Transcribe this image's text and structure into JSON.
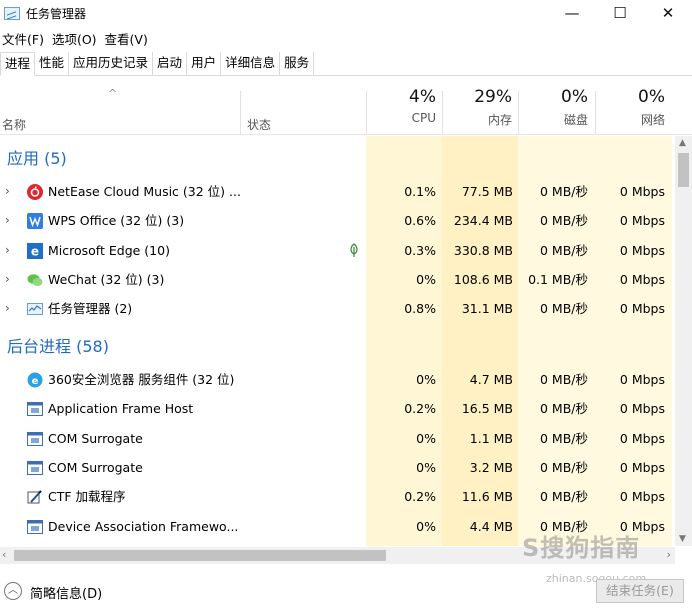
{
  "window": {
    "title": "任务管理器",
    "minimize": "—",
    "maximize": "☐",
    "close": "✕"
  },
  "menu": [
    "文件(F)",
    "选项(O)",
    "查看(V)"
  ],
  "tabs": [
    "进程",
    "性能",
    "应用历史记录",
    "启动",
    "用户",
    "详细信息",
    "服务"
  ],
  "active_tab": "进程",
  "header": {
    "sort_arrow": "^",
    "name": "名称",
    "status": "状态",
    "cpu_pct": "4%",
    "cpu_label": "CPU",
    "mem_pct": "29%",
    "mem_label": "内存",
    "disk_pct": "0%",
    "disk_label": "磁盘",
    "net_pct": "0%",
    "net_label": "网络"
  },
  "groups": {
    "apps_title": "应用 (5)",
    "background_title": "后台进程 (58)"
  },
  "apps": [
    {
      "name": "NetEase Cloud Music (32 位) ...",
      "icon": "netease-music-icon",
      "cpu": "0.1%",
      "mem": "77.5 MB",
      "disk": "0 MB/秒",
      "net": "0 Mbps"
    },
    {
      "name": "WPS Office (32 位) (3)",
      "icon": "wps-icon",
      "cpu": "0.6%",
      "mem": "234.4 MB",
      "disk": "0 MB/秒",
      "net": "0 Mbps"
    },
    {
      "name": "Microsoft Edge (10)",
      "icon": "edge-icon",
      "cpu": "0.3%",
      "mem": "330.8 MB",
      "disk": "0 MB/秒",
      "net": "0 Mbps"
    },
    {
      "name": "WeChat (32 位) (3)",
      "icon": "wechat-icon",
      "cpu": "0%",
      "mem": "108.6 MB",
      "disk": "0.1 MB/秒",
      "net": "0 Mbps"
    },
    {
      "name": "任务管理器 (2)",
      "icon": "task-manager-icon",
      "cpu": "0.8%",
      "mem": "31.1 MB",
      "disk": "0 MB/秒",
      "net": "0 Mbps"
    }
  ],
  "background": [
    {
      "name": "360安全浏览器 服务组件 (32 位)",
      "icon": "360-browser-icon",
      "cpu": "0%",
      "mem": "4.7 MB",
      "disk": "0 MB/秒",
      "net": "0 Mbps"
    },
    {
      "name": "Application Frame Host",
      "icon": "app-window-icon",
      "cpu": "0.2%",
      "mem": "16.5 MB",
      "disk": "0 MB/秒",
      "net": "0 Mbps"
    },
    {
      "name": "COM Surrogate",
      "icon": "app-window-icon",
      "cpu": "0%",
      "mem": "1.1 MB",
      "disk": "0 MB/秒",
      "net": "0 Mbps"
    },
    {
      "name": "COM Surrogate",
      "icon": "app-window-icon",
      "cpu": "0%",
      "mem": "3.2 MB",
      "disk": "0 MB/秒",
      "net": "0 Mbps"
    },
    {
      "name": "CTF 加载程序",
      "icon": "ctf-icon",
      "cpu": "0.2%",
      "mem": "11.6 MB",
      "disk": "0 MB/秒",
      "net": "0 Mbps"
    },
    {
      "name": "Device Association Framewo...",
      "icon": "app-window-icon",
      "cpu": "0%",
      "mem": "4.4 MB",
      "disk": "0 MB/秒",
      "net": "0 Mbps"
    }
  ],
  "footer": {
    "fewer_details": "简略信息(D)",
    "end_task": "结束任务(E)"
  },
  "watermark": {
    "text": "S搜狗指南",
    "url": "zhinan.sogou.com"
  },
  "colors": {
    "heat_light": "#fff9e0",
    "heat_mid": "#fff1c4",
    "group_blue": "#1e6bc4"
  }
}
